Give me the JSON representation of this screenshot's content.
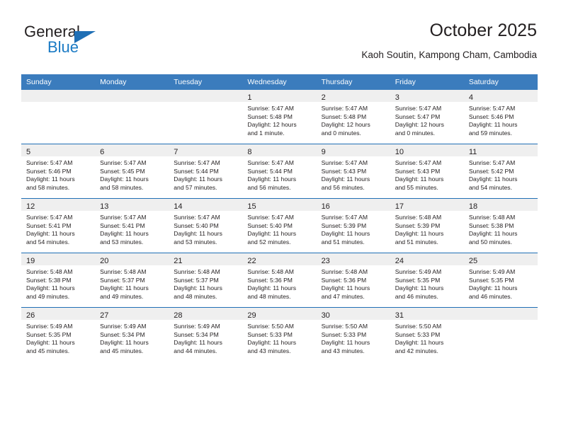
{
  "brand": {
    "name_part1": "General",
    "name_part2": "Blue"
  },
  "header": {
    "title": "October 2025",
    "subtitle": "Kaoh Soutin, Kampong Cham, Cambodia"
  },
  "colors": {
    "header_blue": "#3b7cbd",
    "rule_blue": "#1f6fb5",
    "daynum_band": "#efefef",
    "logo_blue": "#1a7ac4",
    "text": "#231f20"
  },
  "calendar": {
    "weekday_headers": [
      "Sunday",
      "Monday",
      "Tuesday",
      "Wednesday",
      "Thursday",
      "Friday",
      "Saturday"
    ],
    "weeks": [
      [
        {
          "day": "",
          "lines": []
        },
        {
          "day": "",
          "lines": []
        },
        {
          "day": "",
          "lines": []
        },
        {
          "day": "1",
          "lines": [
            "Sunrise: 5:47 AM",
            "Sunset: 5:48 PM",
            "Daylight: 12 hours",
            "and 1 minute."
          ]
        },
        {
          "day": "2",
          "lines": [
            "Sunrise: 5:47 AM",
            "Sunset: 5:48 PM",
            "Daylight: 12 hours",
            "and 0 minutes."
          ]
        },
        {
          "day": "3",
          "lines": [
            "Sunrise: 5:47 AM",
            "Sunset: 5:47 PM",
            "Daylight: 12 hours",
            "and 0 minutes."
          ]
        },
        {
          "day": "4",
          "lines": [
            "Sunrise: 5:47 AM",
            "Sunset: 5:46 PM",
            "Daylight: 11 hours",
            "and 59 minutes."
          ]
        }
      ],
      [
        {
          "day": "5",
          "lines": [
            "Sunrise: 5:47 AM",
            "Sunset: 5:46 PM",
            "Daylight: 11 hours",
            "and 58 minutes."
          ]
        },
        {
          "day": "6",
          "lines": [
            "Sunrise: 5:47 AM",
            "Sunset: 5:45 PM",
            "Daylight: 11 hours",
            "and 58 minutes."
          ]
        },
        {
          "day": "7",
          "lines": [
            "Sunrise: 5:47 AM",
            "Sunset: 5:44 PM",
            "Daylight: 11 hours",
            "and 57 minutes."
          ]
        },
        {
          "day": "8",
          "lines": [
            "Sunrise: 5:47 AM",
            "Sunset: 5:44 PM",
            "Daylight: 11 hours",
            "and 56 minutes."
          ]
        },
        {
          "day": "9",
          "lines": [
            "Sunrise: 5:47 AM",
            "Sunset: 5:43 PM",
            "Daylight: 11 hours",
            "and 56 minutes."
          ]
        },
        {
          "day": "10",
          "lines": [
            "Sunrise: 5:47 AM",
            "Sunset: 5:43 PM",
            "Daylight: 11 hours",
            "and 55 minutes."
          ]
        },
        {
          "day": "11",
          "lines": [
            "Sunrise: 5:47 AM",
            "Sunset: 5:42 PM",
            "Daylight: 11 hours",
            "and 54 minutes."
          ]
        }
      ],
      [
        {
          "day": "12",
          "lines": [
            "Sunrise: 5:47 AM",
            "Sunset: 5:41 PM",
            "Daylight: 11 hours",
            "and 54 minutes."
          ]
        },
        {
          "day": "13",
          "lines": [
            "Sunrise: 5:47 AM",
            "Sunset: 5:41 PM",
            "Daylight: 11 hours",
            "and 53 minutes."
          ]
        },
        {
          "day": "14",
          "lines": [
            "Sunrise: 5:47 AM",
            "Sunset: 5:40 PM",
            "Daylight: 11 hours",
            "and 53 minutes."
          ]
        },
        {
          "day": "15",
          "lines": [
            "Sunrise: 5:47 AM",
            "Sunset: 5:40 PM",
            "Daylight: 11 hours",
            "and 52 minutes."
          ]
        },
        {
          "day": "16",
          "lines": [
            "Sunrise: 5:47 AM",
            "Sunset: 5:39 PM",
            "Daylight: 11 hours",
            "and 51 minutes."
          ]
        },
        {
          "day": "17",
          "lines": [
            "Sunrise: 5:48 AM",
            "Sunset: 5:39 PM",
            "Daylight: 11 hours",
            "and 51 minutes."
          ]
        },
        {
          "day": "18",
          "lines": [
            "Sunrise: 5:48 AM",
            "Sunset: 5:38 PM",
            "Daylight: 11 hours",
            "and 50 minutes."
          ]
        }
      ],
      [
        {
          "day": "19",
          "lines": [
            "Sunrise: 5:48 AM",
            "Sunset: 5:38 PM",
            "Daylight: 11 hours",
            "and 49 minutes."
          ]
        },
        {
          "day": "20",
          "lines": [
            "Sunrise: 5:48 AM",
            "Sunset: 5:37 PM",
            "Daylight: 11 hours",
            "and 49 minutes."
          ]
        },
        {
          "day": "21",
          "lines": [
            "Sunrise: 5:48 AM",
            "Sunset: 5:37 PM",
            "Daylight: 11 hours",
            "and 48 minutes."
          ]
        },
        {
          "day": "22",
          "lines": [
            "Sunrise: 5:48 AM",
            "Sunset: 5:36 PM",
            "Daylight: 11 hours",
            "and 48 minutes."
          ]
        },
        {
          "day": "23",
          "lines": [
            "Sunrise: 5:48 AM",
            "Sunset: 5:36 PM",
            "Daylight: 11 hours",
            "and 47 minutes."
          ]
        },
        {
          "day": "24",
          "lines": [
            "Sunrise: 5:49 AM",
            "Sunset: 5:35 PM",
            "Daylight: 11 hours",
            "and 46 minutes."
          ]
        },
        {
          "day": "25",
          "lines": [
            "Sunrise: 5:49 AM",
            "Sunset: 5:35 PM",
            "Daylight: 11 hours",
            "and 46 minutes."
          ]
        }
      ],
      [
        {
          "day": "26",
          "lines": [
            "Sunrise: 5:49 AM",
            "Sunset: 5:35 PM",
            "Daylight: 11 hours",
            "and 45 minutes."
          ]
        },
        {
          "day": "27",
          "lines": [
            "Sunrise: 5:49 AM",
            "Sunset: 5:34 PM",
            "Daylight: 11 hours",
            "and 45 minutes."
          ]
        },
        {
          "day": "28",
          "lines": [
            "Sunrise: 5:49 AM",
            "Sunset: 5:34 PM",
            "Daylight: 11 hours",
            "and 44 minutes."
          ]
        },
        {
          "day": "29",
          "lines": [
            "Sunrise: 5:50 AM",
            "Sunset: 5:33 PM",
            "Daylight: 11 hours",
            "and 43 minutes."
          ]
        },
        {
          "day": "30",
          "lines": [
            "Sunrise: 5:50 AM",
            "Sunset: 5:33 PM",
            "Daylight: 11 hours",
            "and 43 minutes."
          ]
        },
        {
          "day": "31",
          "lines": [
            "Sunrise: 5:50 AM",
            "Sunset: 5:33 PM",
            "Daylight: 11 hours",
            "and 42 minutes."
          ]
        },
        {
          "day": "",
          "lines": []
        }
      ]
    ]
  }
}
